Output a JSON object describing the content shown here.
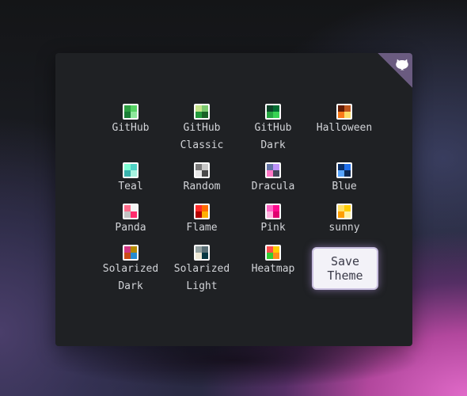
{
  "themes": [
    {
      "label_1": "GitHub",
      "label_2": "",
      "colors": [
        "#2ea043",
        "#56d364",
        "#1a7f37",
        "#8ee89c"
      ]
    },
    {
      "label_1": "GitHub",
      "label_2": "Classic",
      "colors": [
        "#c6e48b",
        "#7bc96f",
        "#239a3b",
        "#196127"
      ]
    },
    {
      "label_1": "GitHub",
      "label_2": "Dark",
      "colors": [
        "#0e4429",
        "#006d32",
        "#26a641",
        "#39d353"
      ]
    },
    {
      "label_1": "Halloween",
      "label_2": "",
      "colors": [
        "#631c03",
        "#bd561d",
        "#fa7a18",
        "#fddf68"
      ]
    },
    {
      "label_1": "Teal",
      "label_2": "",
      "colors": [
        "#7fffd4",
        "#4fd1c5",
        "#38b2ac",
        "#a7f3e0"
      ]
    },
    {
      "label_1": "Random",
      "label_2": "",
      "colors": [
        "#7a7a7a",
        "#c8c8c8",
        "#e8e8e8",
        "#4a4a4a"
      ]
    },
    {
      "label_1": "Dracula",
      "label_2": "",
      "colors": [
        "#6272a4",
        "#bd93f9",
        "#ff79c6",
        "#44475a"
      ]
    },
    {
      "label_1": "Blue",
      "label_2": "",
      "colors": [
        "#0a3069",
        "#1f6feb",
        "#58a6ff",
        "#0d2a55"
      ]
    },
    {
      "label_1": "Panda",
      "label_2": "",
      "colors": [
        "#ff6b8a",
        "#f4f4f4",
        "#c3c3c3",
        "#ff2c6d"
      ]
    },
    {
      "label_1": "Flame",
      "label_2": "",
      "colors": [
        "#ff2a2a",
        "#ff6b00",
        "#b30000",
        "#ffb000"
      ]
    },
    {
      "label_1": "Pink",
      "label_2": "",
      "colors": [
        "#ff66c4",
        "#ff0a8d",
        "#ffb3de",
        "#e0006f"
      ]
    },
    {
      "label_1": "sunny",
      "label_2": "",
      "colors": [
        "#ffe066",
        "#ffcc00",
        "#ff9e00",
        "#fff3a8"
      ]
    },
    {
      "label_1": "Solarized",
      "label_2": "Dark",
      "colors": [
        "#d33682",
        "#b58900",
        "#cb4b16",
        "#268bd2"
      ]
    },
    {
      "label_1": "Solarized",
      "label_2": "Light",
      "colors": [
        "#93a1a1",
        "#586e75",
        "#eee8d5",
        "#073642"
      ]
    },
    {
      "label_1": "Heatmap",
      "label_2": "",
      "colors": [
        "#ff4d4d",
        "#ffcc00",
        "#33cc33",
        "#ff8c1a"
      ]
    }
  ],
  "save_button": {
    "line_1": "Save",
    "line_2": "Theme"
  },
  "corner_link": {
    "icon": "github-octocat-icon",
    "color": "#6a5b80"
  },
  "accent_colors": {
    "panel": "#1f2124",
    "button_glow": "#c9bfe0"
  }
}
